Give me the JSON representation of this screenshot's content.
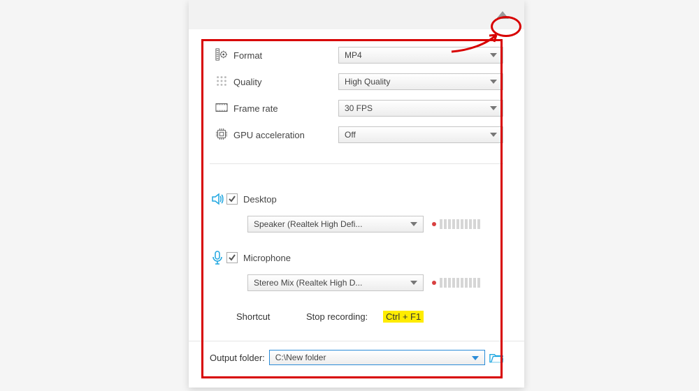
{
  "settings": {
    "format": {
      "label": "Format",
      "value": "MP4"
    },
    "quality": {
      "label": "Quality",
      "value": "High Quality"
    },
    "fps": {
      "label": "Frame rate",
      "value": "30 FPS"
    },
    "gpu": {
      "label": "GPU acceleration",
      "value": "Off"
    }
  },
  "audio": {
    "desktop": {
      "label": "Desktop",
      "device": "Speaker (Realtek High Defi..."
    },
    "mic": {
      "label": "Microphone",
      "device": "Stereo Mix (Realtek High D..."
    }
  },
  "shortcut": {
    "label": "Shortcut",
    "stop_label": "Stop recording:",
    "hotkey": "Ctrl + F1"
  },
  "output": {
    "label": "Output folder:",
    "path": "C:\\New folder"
  }
}
